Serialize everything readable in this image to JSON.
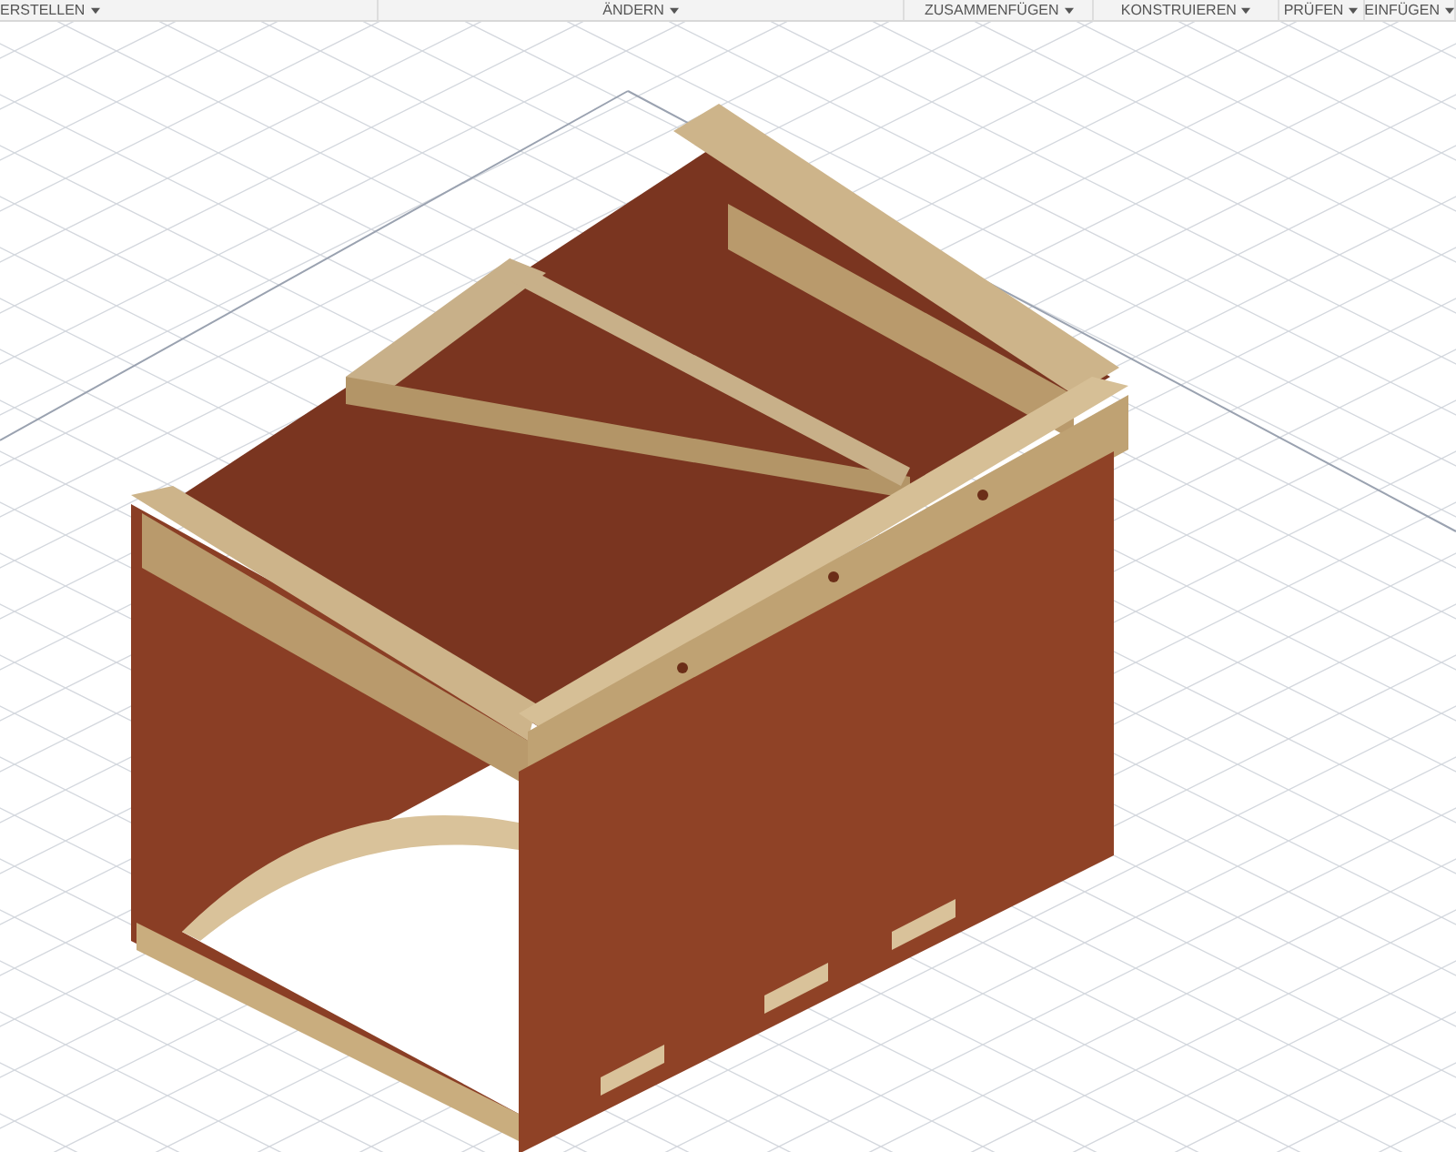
{
  "toolbar": {
    "menus": [
      {
        "label": "ERSTELLEN"
      },
      {
        "label": "ÄNDERN"
      },
      {
        "label": "ZUSAMMENFÜGEN"
      },
      {
        "label": "KONSTRUIEREN"
      },
      {
        "label": "PRÜFEN"
      },
      {
        "label": "EINFÜGEN"
      }
    ]
  }
}
